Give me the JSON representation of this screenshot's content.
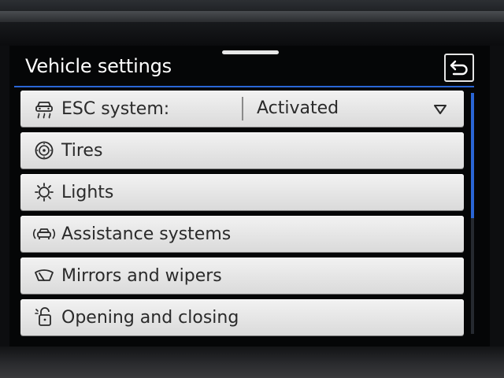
{
  "header": {
    "title": "Vehicle settings"
  },
  "menu": {
    "items": [
      {
        "label": "ESC system:",
        "icon": "esc-skid-car-icon",
        "value": "Activated",
        "has_dropdown": true
      },
      {
        "label": "Tires",
        "icon": "tire-icon"
      },
      {
        "label": "Lights",
        "icon": "light-bulb-icon"
      },
      {
        "label": "Assistance systems",
        "icon": "assist-car-icon"
      },
      {
        "label": "Mirrors and wipers",
        "icon": "wiper-icon"
      },
      {
        "label": "Opening and closing",
        "icon": "lock-icon"
      }
    ]
  },
  "scroll": {
    "position_fraction": 0.0,
    "visible_fraction": 0.52
  },
  "colors": {
    "accent": "#2a66d6",
    "row_background": "#e6e6e6",
    "text_dark": "#2a2a2a",
    "screen_background": "#050607"
  }
}
